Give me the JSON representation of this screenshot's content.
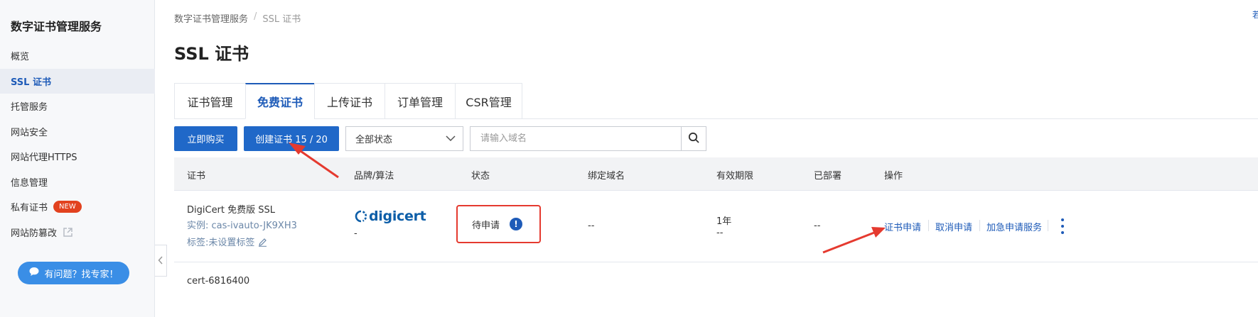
{
  "sidebar": {
    "title": "数字证书管理服务",
    "items": [
      {
        "label": "概览"
      },
      {
        "label": "SSL 证书"
      },
      {
        "label": "托管服务"
      },
      {
        "label": "网站安全"
      },
      {
        "label": "网站代理HTTPS"
      },
      {
        "label": "信息管理"
      },
      {
        "label": "私有证书",
        "badge": "NEW"
      },
      {
        "label": "网站防篡改"
      }
    ],
    "help_button": "有问题？找专家！"
  },
  "header": {
    "breadcrumb": [
      "数字证书管理服务",
      "/",
      "SSL 证书"
    ],
    "title": "SSL 证书",
    "top_right_link": "若"
  },
  "tabs": [
    "证书管理",
    "免费证书",
    "上传证书",
    "订单管理",
    "CSR管理"
  ],
  "active_tab": "免费证书",
  "toolbar": {
    "buy_button": "立即购买",
    "create_button": "创建证书 15 / 20",
    "status_select": "全部状态",
    "search_placeholder": "请输入域名"
  },
  "table": {
    "columns": [
      "证书",
      "品牌/算法",
      "状态",
      "绑定域名",
      "有效期限",
      "已部署",
      "操作"
    ],
    "rows": [
      {
        "name": "DigiCert 免费版 SSL",
        "instance": "实例: cas-ivauto-JK9XH3",
        "tag": "标签:未设置标签",
        "brand_logo": "digicert",
        "algorithm": "-",
        "status": "待申请",
        "status_icon": "!",
        "domains": "--",
        "validity": "1年",
        "validity_sub": "--",
        "deployed": "--",
        "actions": [
          "证书申请",
          "取消申请",
          "加急申请服务"
        ]
      },
      {
        "name": "cert-6816400"
      }
    ]
  },
  "colors": {
    "primary": "#2068c8",
    "link": "#1e5bb8",
    "annotation_red": "#e53a2f",
    "badge_red": "#e2421f"
  }
}
